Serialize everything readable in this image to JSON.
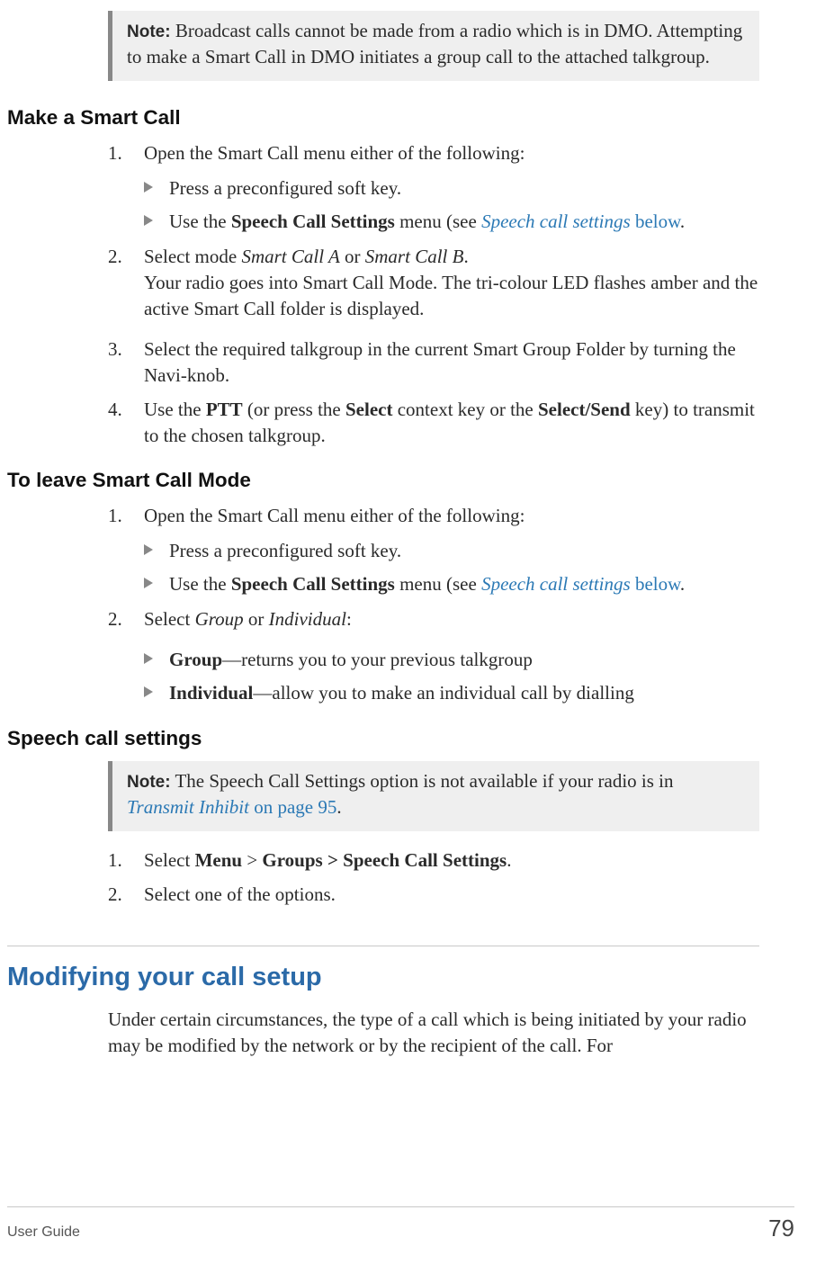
{
  "note1": {
    "label": "Note:",
    "text": "Broadcast calls cannot be made from a radio which is in DMO. Attempting to make a Smart Call in DMO initiates a group call to the attached talkgroup."
  },
  "sectionA": {
    "heading": "Make a Smart Call",
    "items": [
      {
        "num": "1.",
        "text": "Open the Smart Call menu either of the following:",
        "subs": [
          {
            "plain": "Press a preconfigured soft key."
          },
          {
            "pre": "Use the ",
            "bold": "Speech Call Settings",
            "mid": " menu (see ",
            "link": "Speech call settings",
            "after": " below",
            "end": "."
          }
        ]
      },
      {
        "num": "2.",
        "pre": "Select mode ",
        "it1": "Smart Call A",
        "mid": " or ",
        "it2": "Smart Call B",
        "end": ".",
        "para2": "Your radio goes into Smart Call Mode. The tri-colour LED flashes amber and the active Smart Call folder is displayed."
      },
      {
        "num": "3.",
        "text": "Select the required talkgroup in the current Smart Group Folder by turning the Navi-knob."
      },
      {
        "num": "4.",
        "pre": "Use the ",
        "b1": "PTT",
        "mid1": " (or press the ",
        "b2": "Select",
        "mid2": " context key or the ",
        "b3": "Select/Send",
        "end": " key) to transmit to the chosen talkgroup."
      }
    ]
  },
  "sectionB": {
    "heading": "To leave Smart Call Mode",
    "items": [
      {
        "num": "1.",
        "text": "Open the Smart Call menu either of the following:",
        "subs": [
          {
            "plain": "Press a preconfigured soft key."
          },
          {
            "pre": "Use the ",
            "bold": "Speech Call Settings",
            "mid": " menu (see ",
            "link": "Speech call settings",
            "after": " below",
            "end": "."
          }
        ]
      },
      {
        "num": "2.",
        "pre": "Select ",
        "it1": "Group",
        "mid": " or ",
        "it2": "Individual",
        "end": ":",
        "subs": [
          {
            "bold": "Group",
            "rest": "—returns you to your previous talkgroup"
          },
          {
            "bold": "Individual",
            "rest": "—allow you to make an individual call by dialling"
          }
        ]
      }
    ]
  },
  "sectionC": {
    "heading": "Speech call settings",
    "note": {
      "label": "Note:",
      "pre": "The Speech Call Settings option is not available if your radio is in ",
      "link": "Transmit Inhibit",
      "page": " on page 95",
      "end": "."
    },
    "items": [
      {
        "num": "1.",
        "pre": "Select ",
        "b1": "Menu",
        "mid1": " > ",
        "b2": "Groups > Speech Call Settings",
        "end": "."
      },
      {
        "num": "2.",
        "text": "Select one of the options."
      }
    ]
  },
  "sectionD": {
    "heading": "Modifying your call setup",
    "para": "Under certain circumstances, the type of a call which is being initiated by your radio may be modified by the network or by the recipient of the call. For"
  },
  "footer": {
    "left": "User Guide",
    "right": "79"
  }
}
